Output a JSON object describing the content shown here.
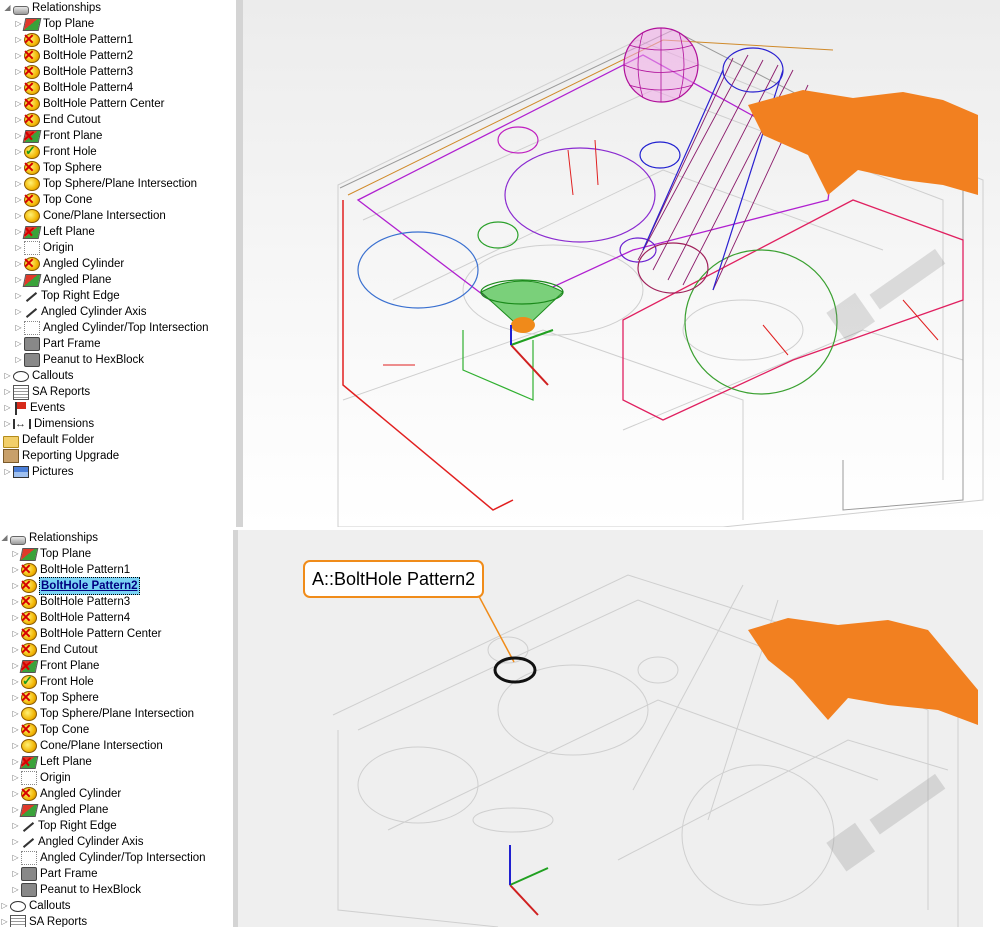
{
  "top_tree": {
    "root_label": "Relationships",
    "items": [
      {
        "label": "Top Plane",
        "icon": "plane-icon"
      },
      {
        "label": "BoltHole Pattern1",
        "icon": "failed-relationship-icon"
      },
      {
        "label": "BoltHole Pattern2",
        "icon": "failed-relationship-icon"
      },
      {
        "label": "BoltHole Pattern3",
        "icon": "failed-relationship-icon"
      },
      {
        "label": "BoltHole Pattern4",
        "icon": "failed-relationship-icon"
      },
      {
        "label": "BoltHole Pattern Center",
        "icon": "failed-relationship-icon"
      },
      {
        "label": "End Cutout",
        "icon": "failed-relationship-icon"
      },
      {
        "label": "Front Plane",
        "icon": "plane-icon"
      },
      {
        "label": "Front Hole",
        "icon": "passed-relationship-icon"
      },
      {
        "label": "Top Sphere",
        "icon": "failed-relationship-icon"
      },
      {
        "label": "Top Sphere/Plane Intersection",
        "icon": "relationship-icon"
      },
      {
        "label": "Top Cone",
        "icon": "failed-relationship-icon"
      },
      {
        "label": "Cone/Plane Intersection",
        "icon": "relationship-icon"
      },
      {
        "label": "Left Plane",
        "icon": "plane-icon"
      },
      {
        "label": "Origin",
        "icon": "origin-icon"
      },
      {
        "label": "Angled Cylinder",
        "icon": "failed-relationship-icon"
      },
      {
        "label": "Angled Plane",
        "icon": "plane-icon"
      },
      {
        "label": "Top Right Edge",
        "icon": "line-icon"
      },
      {
        "label": "Angled Cylinder Axis",
        "icon": "line-icon"
      },
      {
        "label": "Angled Cylinder/Top Intersection",
        "icon": "origin-icon"
      },
      {
        "label": "Part Frame",
        "icon": "frame-icon"
      },
      {
        "label": "Peanut to HexBlock",
        "icon": "frame-icon"
      }
    ],
    "after": [
      {
        "label": "Callouts",
        "icon": "callout-icon"
      },
      {
        "label": "SA Reports",
        "icon": "report-icon"
      },
      {
        "label": "Events",
        "icon": "flag-icon"
      },
      {
        "label": "Dimensions",
        "icon": "dimension-icon"
      },
      {
        "label": "Default Folder",
        "icon": "folder-icon"
      },
      {
        "label": "Reporting Upgrade",
        "icon": "box-icon"
      },
      {
        "label": "Pictures",
        "icon": "picture-icon"
      }
    ]
  },
  "bottom_tree": {
    "root_label": "Relationships",
    "selected_label": "BoltHole Pattern2",
    "after": [
      {
        "label": "Callouts",
        "icon": "callout-icon"
      },
      {
        "label": "SA Reports",
        "icon": "report-icon"
      }
    ]
  },
  "bottom_view": {
    "callout_text": "A::BoltHole Pattern2"
  },
  "colors": {
    "selection": "#79d3f5",
    "callout_border": "#f08c1a",
    "point_cloud": "#f07c0a"
  }
}
